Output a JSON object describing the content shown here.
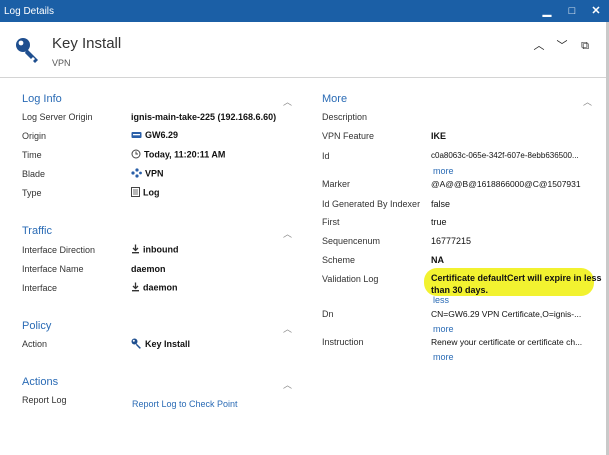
{
  "window": {
    "title": "Log Details",
    "min": "▁",
    "max": "□",
    "close": "✕"
  },
  "header": {
    "title": "Key Install",
    "subtitle": "VPN",
    "up": "︿",
    "down": "﹀",
    "copy": "⧉"
  },
  "log_info": {
    "title": "Log Info",
    "rows": [
      {
        "label": "Log Server Origin",
        "value": "ignis-main-take-225 (192.168.6.60)"
      },
      {
        "label": "Origin",
        "value": "GW6.29"
      },
      {
        "label": "Time",
        "value": "Today, 11:20:11 AM"
      },
      {
        "label": "Blade",
        "value": "VPN"
      },
      {
        "label": "Type",
        "value": "Log"
      }
    ]
  },
  "traffic": {
    "title": "Traffic",
    "rows": [
      {
        "label": "Interface Direction",
        "value": "inbound"
      },
      {
        "label": "Interface Name",
        "value": "daemon"
      },
      {
        "label": "Interface",
        "value": "daemon"
      }
    ]
  },
  "policy": {
    "title": "Policy",
    "rows": [
      {
        "label": "Action",
        "value": "Key Install"
      }
    ]
  },
  "actions": {
    "title": "Actions",
    "rows": [
      {
        "label": "Report Log",
        "value": "Report Log to Check Point"
      }
    ]
  },
  "more": {
    "title": "More",
    "rows": [
      {
        "label": "Description",
        "value": ""
      },
      {
        "label": "VPN Feature",
        "value": "IKE"
      },
      {
        "label": "Id",
        "value": "c0a8063c-065e-342f-607e-8ebb636500...",
        "link": "more"
      },
      {
        "label": "Marker",
        "value": "@A@@B@1618866000@C@1507931"
      },
      {
        "label": "Id Generated By Indexer",
        "value": "false"
      },
      {
        "label": "First",
        "value": "true"
      },
      {
        "label": "Sequencenum",
        "value": "16777215"
      },
      {
        "label": "Scheme",
        "value": "NA"
      },
      {
        "label": "Validation Log",
        "value_line1": "Certificate defaultCert will expire in less",
        "value_line2": "than 30 days.",
        "link": "less"
      },
      {
        "label": "Dn",
        "value": "CN=GW6.29 VPN Certificate,O=ignis-...",
        "link": "more"
      },
      {
        "label": "Instruction",
        "value": "Renew your certificate or certificate ch...",
        "link": "more"
      }
    ]
  },
  "collapse_glyph": "︿"
}
